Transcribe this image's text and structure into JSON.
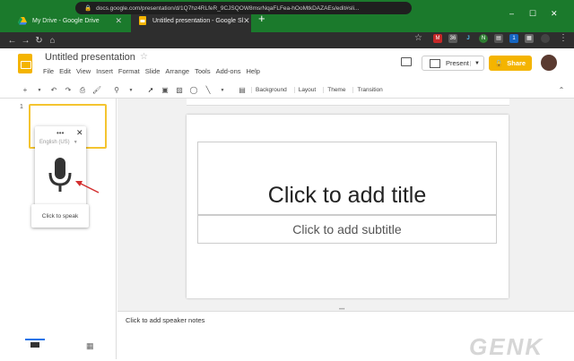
{
  "browser": {
    "tabs": [
      {
        "label": "My Drive - Google Drive"
      },
      {
        "label": "Untitled presentation - Google Sl"
      }
    ],
    "url": "docs.google.com/presentation/d/1Q7hz4RLfeR_9CJSQOW8msrNqaFLFea-hOoMtkDAZAEs/edit#sli...",
    "new_tab": "+",
    "window_controls": [
      "–",
      "☐",
      "✕"
    ],
    "extension_badge": "36"
  },
  "app": {
    "title": "Untitled presentation",
    "menus": [
      "File",
      "Edit",
      "View",
      "Insert",
      "Format",
      "Slide",
      "Arrange",
      "Tools",
      "Add-ons",
      "Help"
    ],
    "present_label": "Present",
    "share_label": "Share",
    "accent": "#f4b400"
  },
  "toolbar": {
    "background": "Background",
    "layout": "Layout",
    "theme": "Theme",
    "transition": "Transition"
  },
  "filmstrip": {
    "slide_number": "1"
  },
  "voice_typing": {
    "language": "English (US)",
    "tooltip": "Click to speak",
    "dots": "•••",
    "close": "✕"
  },
  "slide": {
    "title_placeholder": "Click to add title",
    "subtitle_placeholder": "Click to add subtitle"
  },
  "notes": {
    "placeholder": "Click to add speaker notes"
  },
  "watermark": "GENK"
}
